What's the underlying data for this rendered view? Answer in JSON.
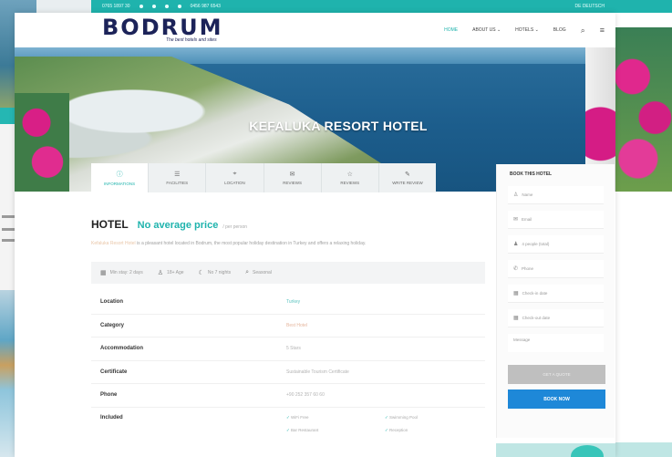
{
  "topbar": {
    "phone": "0765 1897 30",
    "email": "0456 987 6543",
    "right_text": "DE    DEUTSCH"
  },
  "header": {
    "logo": "BODRUM",
    "tagline": "The best hotels and sites",
    "nav": [
      {
        "label": "HOME",
        "active": true
      },
      {
        "label": "ABOUT US",
        "active": false
      },
      {
        "label": "HOTELS",
        "active": false
      },
      {
        "label": "BLOG",
        "active": false
      }
    ],
    "icons": [
      "search-icon",
      "menu-icon"
    ]
  },
  "hero": {
    "title": "KEFALUKA RESORT HOTEL"
  },
  "tabs": [
    {
      "label": "INFORMATIONS",
      "icon": "info-icon",
      "active": true
    },
    {
      "label": "FACILITIES",
      "icon": "list-icon",
      "active": false
    },
    {
      "label": "LOCATION",
      "icon": "pin-icon",
      "active": false
    },
    {
      "label": "REVIEWS",
      "icon": "comment-icon",
      "active": false
    },
    {
      "label": "REVIEWS",
      "icon": "star-icon",
      "active": false
    },
    {
      "label": "WRITE REVIEW",
      "icon": "pen-icon",
      "active": false
    }
  ],
  "hotel": {
    "title": "HOTEL",
    "price": "No average price",
    "price_sub": "/ per person",
    "description_lead": "Kefaluka Resort Hotel",
    "description": " is a pleasant hotel located in Bodrum, the most popular holiday destination in Turkey and offers a relaxing holiday."
  },
  "meta": [
    {
      "icon": "calendar-icon",
      "text": "Min stay: 2 days"
    },
    {
      "icon": "user-icon",
      "text": "18+ Age"
    },
    {
      "icon": "moon-icon",
      "text": "No 7 nights"
    },
    {
      "icon": "search-icon",
      "text": "Seasonal"
    }
  ],
  "info": [
    {
      "label": "Location",
      "value": "Turkey",
      "style": "teal"
    },
    {
      "label": "Category",
      "value": "Best Hotel",
      "style": "peach"
    },
    {
      "label": "Accommodation",
      "value": "5 Stars",
      "style": "grey"
    },
    {
      "label": "Certificate",
      "value": "Sustainable Tourism Certificate",
      "style": "grey"
    },
    {
      "label": "Phone",
      "value": "+90 252 357 60 60",
      "style": "grey"
    },
    {
      "label": "Included",
      "value": "",
      "style": "grey"
    }
  ],
  "included": [
    "WiFi Free",
    "Swimming Pool",
    "Bar Restaurant",
    "Reception"
  ],
  "booking": {
    "title": "BOOK THIS HOTEL",
    "fields": [
      {
        "icon": "user-icon",
        "placeholder": "Name"
      },
      {
        "icon": "mail-icon",
        "placeholder": "Email"
      },
      {
        "icon": "users-icon",
        "placeholder": "4 people (total)"
      },
      {
        "icon": "phone-icon",
        "placeholder": "Phone"
      },
      {
        "icon": "calendar-icon",
        "placeholder": "Check-in date"
      },
      {
        "icon": "calendar-icon",
        "placeholder": "Check-out date"
      }
    ],
    "message_placeholder": "Message",
    "secondary_button": "GET A QUOTE",
    "primary_button": "BOOK NOW"
  }
}
